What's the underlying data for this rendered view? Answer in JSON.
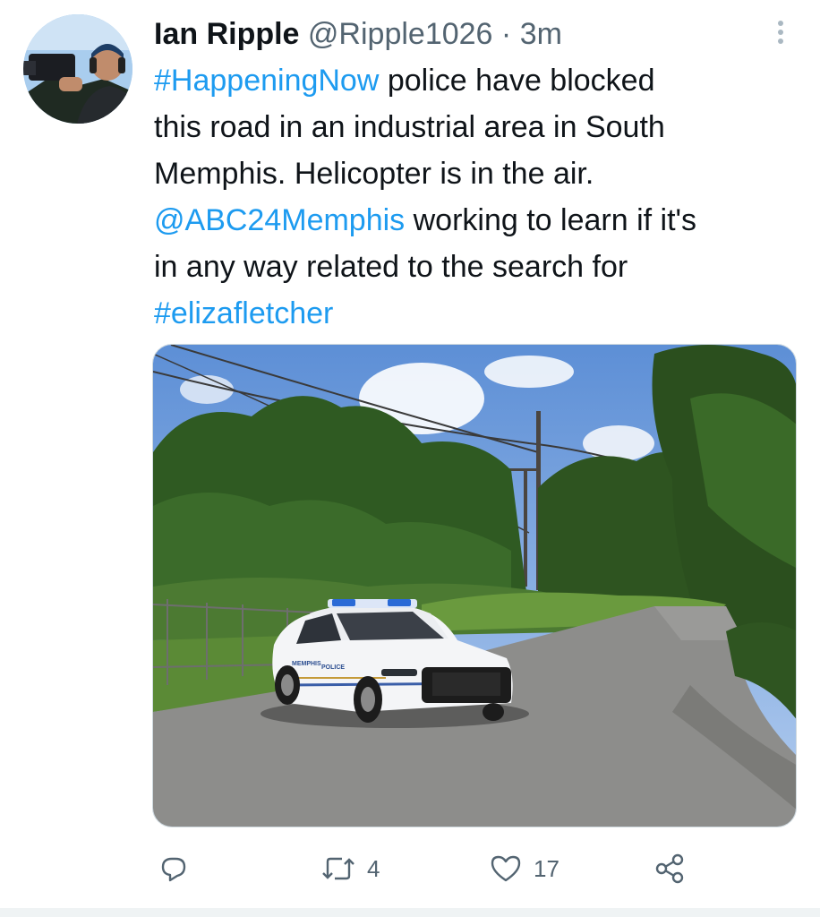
{
  "tweet": {
    "author_name": "Ian Ripple",
    "handle": "@Ripple1026",
    "separator": "·",
    "time": "3m",
    "text_lines": [
      [
        {
          "text": "#HappeningNow",
          "link": true
        },
        {
          "text": " police have blocked",
          "link": false
        }
      ],
      [
        {
          "text": "this road in an industrial area in South",
          "link": false
        }
      ],
      [
        {
          "text": "Memphis. Helicopter is in the air.",
          "link": false
        }
      ],
      [
        {
          "text": "@ABC24Memphis",
          "link": true
        },
        {
          "text": " working to learn if it's",
          "link": false
        }
      ],
      [
        {
          "text": "in any way related to the search for",
          "link": false
        }
      ],
      [
        {
          "text": "#elizafletcher",
          "link": true
        }
      ]
    ],
    "media": {
      "car_door_text": "MEMPHIS",
      "car_police_text": "POLICE"
    },
    "actions": {
      "reply": {
        "icon": "reply-icon",
        "count": ""
      },
      "retweet": {
        "icon": "retweet-icon",
        "count": "4"
      },
      "like": {
        "icon": "heart-icon",
        "count": "17"
      },
      "share": {
        "icon": "share-icon",
        "count": ""
      }
    }
  },
  "colors": {
    "link": "#1d9bf0",
    "text": "#0f1419",
    "secondary": "#536471"
  }
}
